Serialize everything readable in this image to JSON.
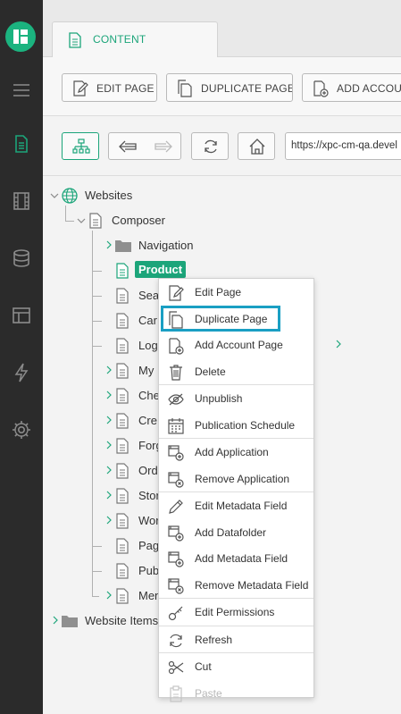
{
  "rail": {
    "icons": [
      "app-logo-icon",
      "menu-icon",
      "document-icon",
      "film-icon",
      "database-icon",
      "layout-icon",
      "lightning-icon",
      "gear-icon"
    ]
  },
  "tabs": [
    {
      "label": "CONTENT",
      "icon": "document-icon"
    }
  ],
  "toolbar": {
    "edit_page": "EDIT PAGE",
    "duplicate_page": "DUPLICATE PAGE",
    "add_account": "ADD ACCOUN"
  },
  "navbar": {
    "url": "https://xpc-cm-qa.devel"
  },
  "tree": {
    "root": "Websites",
    "composer": "Composer",
    "items": [
      {
        "label": "Navigation",
        "type": "folder",
        "expandable": true
      },
      {
        "label": "Product",
        "type": "page",
        "expandable": false,
        "selected": true
      },
      {
        "label": "Sea",
        "type": "page",
        "expandable": false
      },
      {
        "label": "Car",
        "type": "page",
        "expandable": false
      },
      {
        "label": "Log",
        "type": "page",
        "expandable": false
      },
      {
        "label": "My",
        "type": "page",
        "expandable": true
      },
      {
        "label": "Che",
        "type": "page",
        "expandable": true
      },
      {
        "label": "Cre",
        "type": "page",
        "expandable": true
      },
      {
        "label": "Forg",
        "type": "page",
        "expandable": true
      },
      {
        "label": "Ord",
        "type": "page",
        "expandable": true
      },
      {
        "label": "Stor",
        "type": "page",
        "expandable": true
      },
      {
        "label": "Wor",
        "type": "page",
        "expandable": true
      },
      {
        "label": "Pag",
        "type": "page",
        "expandable": false
      },
      {
        "label": "Pub",
        "type": "page",
        "expandable": false
      },
      {
        "label": "Men",
        "type": "page",
        "expandable": true
      }
    ],
    "website_items": "Website Items"
  },
  "context_menu": {
    "items": [
      {
        "label": "Edit Page",
        "icon": "edit-page-icon"
      },
      {
        "label": "Duplicate Page",
        "icon": "duplicate-icon",
        "highlighted": true
      },
      {
        "label": "Add Account Page",
        "icon": "add-page-icon",
        "submenu": true
      },
      {
        "label": "Delete",
        "icon": "trash-icon"
      },
      {
        "label": "Unpublish",
        "icon": "eye-slash-icon"
      },
      {
        "label": "Publication Schedule",
        "icon": "calendar-icon"
      },
      {
        "label": "Add Application",
        "icon": "add-application-icon"
      },
      {
        "label": "Remove Application",
        "icon": "remove-application-icon"
      },
      {
        "label": "Edit Metadata Field",
        "icon": "pencil-icon"
      },
      {
        "label": "Add Datafolder",
        "icon": "add-datafolder-icon"
      },
      {
        "label": "Add Metadata Field",
        "icon": "add-metadata-icon"
      },
      {
        "label": "Remove Metadata Field",
        "icon": "remove-metadata-icon"
      },
      {
        "label": "Edit Permissions",
        "icon": "key-icon"
      },
      {
        "label": "Refresh",
        "icon": "refresh-icon"
      },
      {
        "label": "Cut",
        "icon": "scissors-icon"
      },
      {
        "label": "Paste",
        "icon": "clipboard-icon",
        "disabled": true
      }
    ]
  },
  "colors": {
    "accent": "#1ca57a",
    "rail_bg": "#2b2b2b",
    "highlight_outline": "#1a9fc3"
  }
}
